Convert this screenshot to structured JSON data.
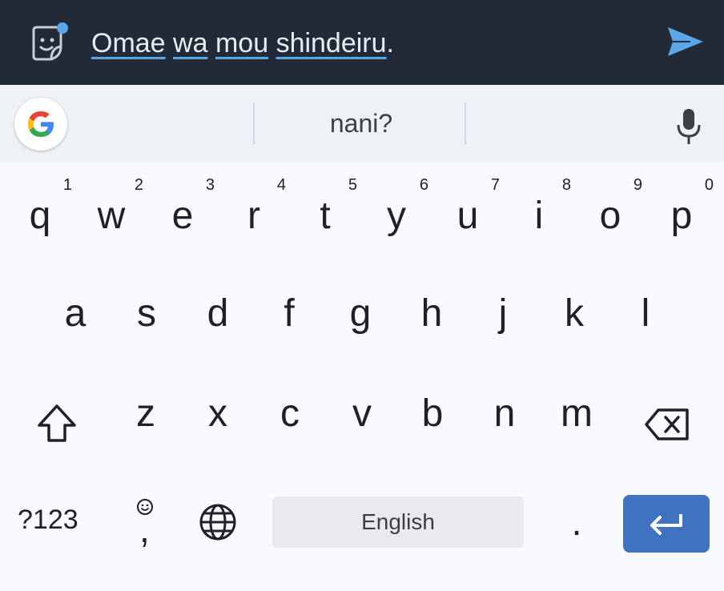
{
  "compose": {
    "words": [
      "Omae",
      "wa",
      "mou",
      "shindeiru"
    ],
    "trailing": ".",
    "sticker_icon": "sticker-smile-icon",
    "send_icon": "send-icon",
    "accent": "#5aa6e6"
  },
  "suggestions": {
    "google_icon": "google-g-icon",
    "center": "nani?",
    "mic_icon": "microphone-icon"
  },
  "keyboard": {
    "row1": [
      {
        "k": "q",
        "h": "1"
      },
      {
        "k": "w",
        "h": "2"
      },
      {
        "k": "e",
        "h": "3"
      },
      {
        "k": "r",
        "h": "4"
      },
      {
        "k": "t",
        "h": "5"
      },
      {
        "k": "y",
        "h": "6"
      },
      {
        "k": "u",
        "h": "7"
      },
      {
        "k": "i",
        "h": "8"
      },
      {
        "k": "o",
        "h": "9"
      },
      {
        "k": "p",
        "h": "0"
      }
    ],
    "row2": [
      "a",
      "s",
      "d",
      "f",
      "g",
      "h",
      "j",
      "k",
      "l"
    ],
    "row3": [
      "z",
      "x",
      "c",
      "v",
      "b",
      "n",
      "m"
    ],
    "symbols_label": "?123",
    "comma": ",",
    "space_label": "English",
    "period": ".",
    "enter_color": "#3f73bf"
  }
}
